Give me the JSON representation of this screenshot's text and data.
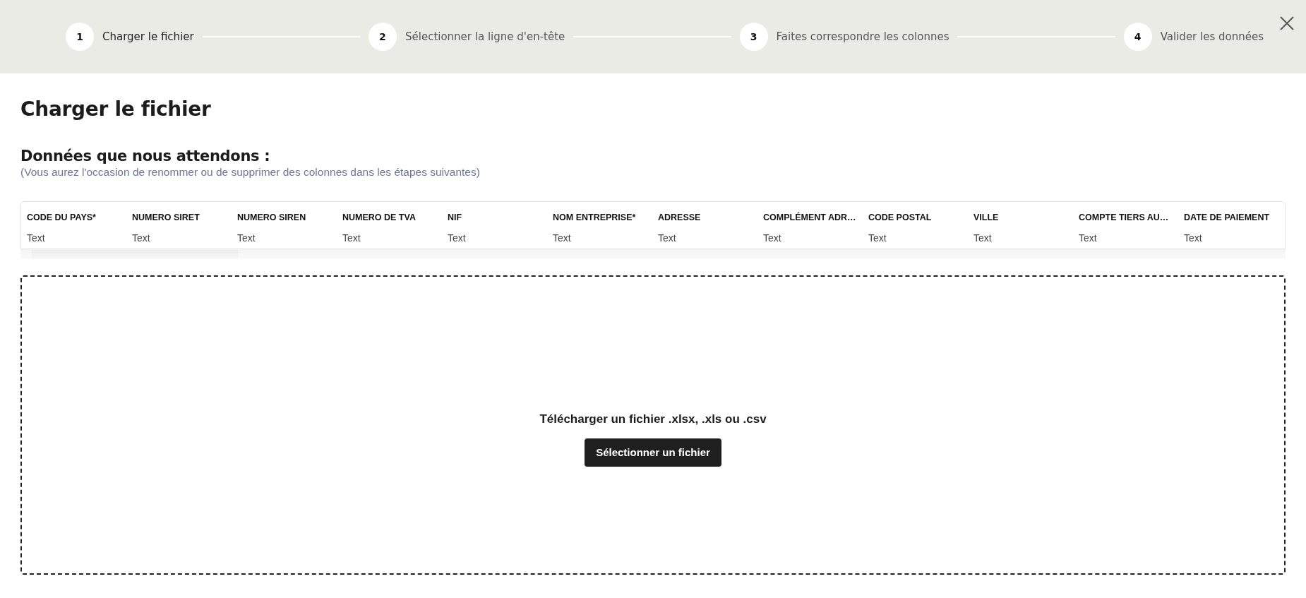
{
  "stepper": {
    "steps": [
      {
        "number": "1",
        "label": "Charger le fichier",
        "selected": true
      },
      {
        "number": "2",
        "label": "Sélectionner la ligne d'en-tête",
        "selected": false
      },
      {
        "number": "3",
        "label": "Faites correspondre les colonnes",
        "selected": false
      },
      {
        "number": "4",
        "label": "Valider les données",
        "selected": false
      }
    ]
  },
  "page_title": "Charger le fichier",
  "expected": {
    "heading": "Données que nous attendons :",
    "note": "(Vous aurez l'occasion de renommer ou de supprimer des colonnes dans les étapes suivantes)"
  },
  "table": {
    "columns": [
      {
        "header": "CODE DU PAYS*",
        "sample": "Text"
      },
      {
        "header": "NUMERO SIRET",
        "sample": "Text"
      },
      {
        "header": "NUMERO SIREN",
        "sample": "Text"
      },
      {
        "header": "NUMERO DE TVA",
        "sample": "Text"
      },
      {
        "header": "NIF",
        "sample": "Text"
      },
      {
        "header": "NOM ENTREPRISE*",
        "sample": "Text"
      },
      {
        "header": "ADRESSE",
        "sample": "Text"
      },
      {
        "header": "COMPLÉMENT ADR…",
        "sample": "Text"
      },
      {
        "header": "CODE POSTAL",
        "sample": "Text"
      },
      {
        "header": "VILLE",
        "sample": "Text"
      },
      {
        "header": "COMPTE TIERS AU…",
        "sample": "Text"
      },
      {
        "header": "DATE DE PAIEMENT",
        "sample": "Text"
      }
    ]
  },
  "dropzone": {
    "prompt": "Télécharger un fichier .xlsx, .xls ou .csv",
    "button": "Sélectionner un fichier"
  }
}
